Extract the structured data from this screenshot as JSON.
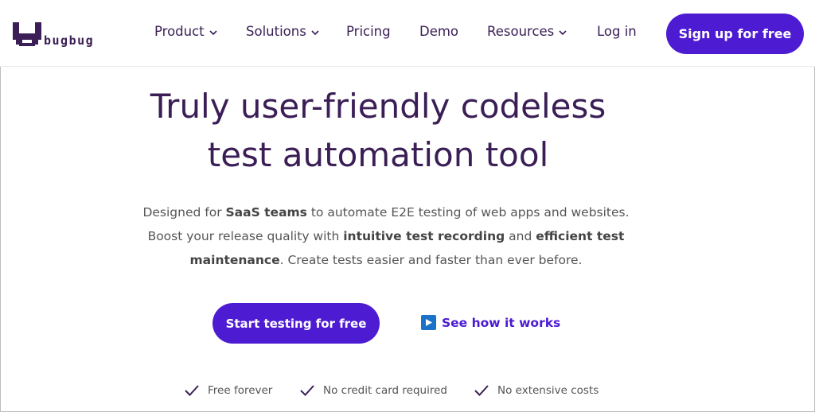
{
  "header": {
    "logo_text": "bugbug",
    "nav": [
      {
        "label": "Product",
        "has_dropdown": true
      },
      {
        "label": "Solutions",
        "has_dropdown": true
      },
      {
        "label": "Pricing",
        "has_dropdown": false
      },
      {
        "label": "Demo",
        "has_dropdown": false
      },
      {
        "label": "Resources",
        "has_dropdown": true
      }
    ],
    "login_label": "Log in",
    "signup_label": "Sign up for free"
  },
  "hero": {
    "title_line1": "Truly user-friendly codeless",
    "title_line2": "test automation tool",
    "subtitle": {
      "p1": "Designed for ",
      "b1": "SaaS teams",
      "p2": " to automate E2E testing of web apps and websites. Boost your release quality with ",
      "b2": "intuitive test recording",
      "p3": " and ",
      "b3": "efficient test maintenance",
      "p4": ". Create tests easier and faster than ever before."
    },
    "start_label": "Start testing for free",
    "see_how_label": "See how it works"
  },
  "features": [
    "Free forever",
    "No credit card required",
    "No extensive costs"
  ],
  "colors": {
    "accent": "#4d1bd2",
    "text_dark": "#3a1e55",
    "text_body": "#555555",
    "play_icon": "#1a73c9"
  },
  "icons": {
    "logo": "bugbug-logo-icon",
    "dropdown": "chevron-down-icon",
    "play": "play-icon",
    "check": "check-icon"
  }
}
